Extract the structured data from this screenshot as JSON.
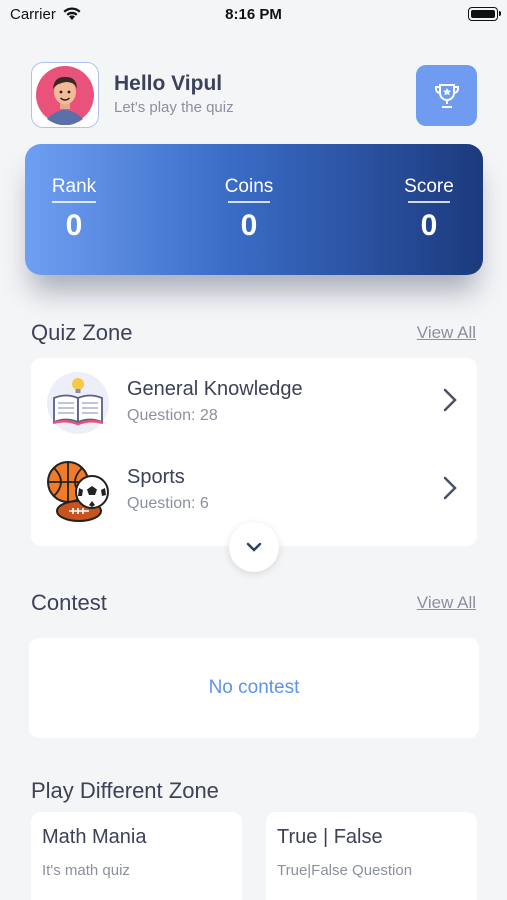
{
  "status_bar": {
    "carrier": "Carrier",
    "time": "8:16 PM"
  },
  "header": {
    "greeting": "Hello Vipul",
    "subtitle": "Let's play the quiz"
  },
  "stats": [
    {
      "label": "Rank",
      "value": "0"
    },
    {
      "label": "Coins",
      "value": "0"
    },
    {
      "label": "Score",
      "value": "0"
    }
  ],
  "quiz_zone": {
    "title": "Quiz Zone",
    "view_all": "View All",
    "items": [
      {
        "title": "General Knowledge",
        "subtitle": "Question: 28",
        "icon": "book-lightbulb-icon"
      },
      {
        "title": "Sports",
        "subtitle": "Question: 6",
        "icon": "sports-balls-icon"
      }
    ]
  },
  "contest": {
    "title": "Contest",
    "view_all": "View All",
    "empty_text": "No contest"
  },
  "play_zone": {
    "title": "Play Different Zone",
    "cards": [
      {
        "title": "Math Mania",
        "subtitle": "It's math quiz"
      },
      {
        "title": "True | False",
        "subtitle": "True|False Question"
      }
    ]
  },
  "colors": {
    "accent": "#6f9cf0",
    "gradient_start": "#6e9ff2",
    "gradient_end": "#1c3a7e",
    "link_blue": "#5e93ea"
  }
}
